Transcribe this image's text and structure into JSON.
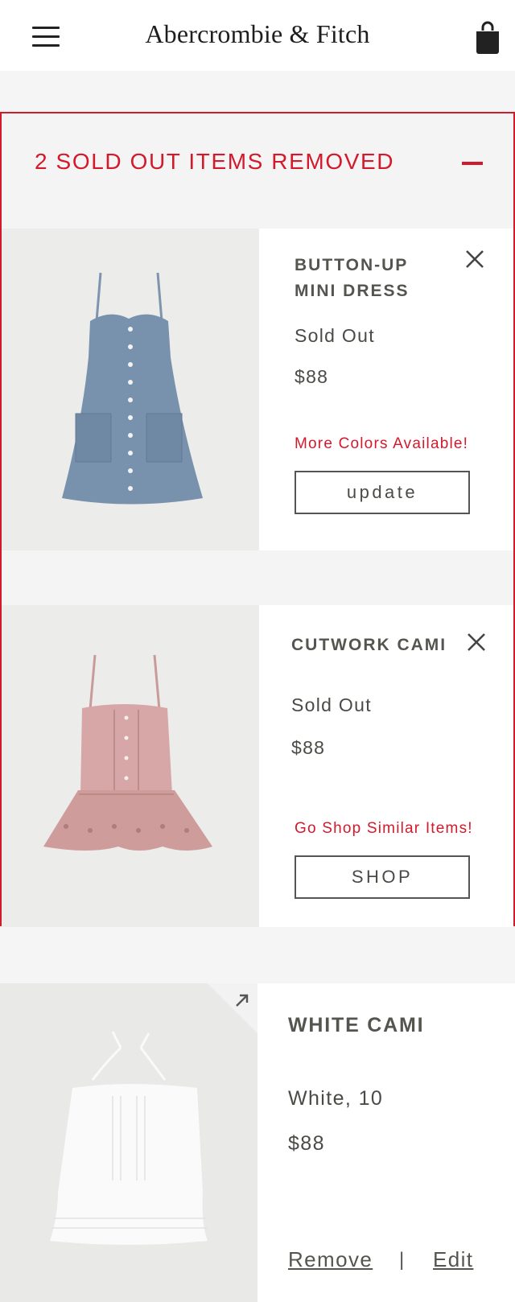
{
  "header": {
    "brand": "Abercrombie & Fitch",
    "menu_icon": "hamburger-menu-icon",
    "bag_icon": "shopping-bag-icon"
  },
  "sold_out": {
    "title": "2 SOLD OUT ITEMS REMOVED",
    "toggle_icon": "minus-icon",
    "accent_color": "#d21a2c",
    "items": [
      {
        "name_line1": "BUTTON-UP",
        "name_line2": "MINI DRESS",
        "status": "Sold Out",
        "price": "$88",
        "note": "More Colors Available!",
        "button_label": "update"
      },
      {
        "name_line1": "CUTWORK CAMI",
        "status": "Sold Out",
        "price": "$88",
        "note": "Go Shop Similar Items!",
        "button_label": "SHOP"
      }
    ]
  },
  "cart_item": {
    "name": "WHITE CAMI",
    "variant": "White, 10",
    "price": "$88",
    "remove_label": "Remove",
    "separator": "|",
    "edit_label": "Edit",
    "expand_icon": "expand-arrow-icon"
  }
}
